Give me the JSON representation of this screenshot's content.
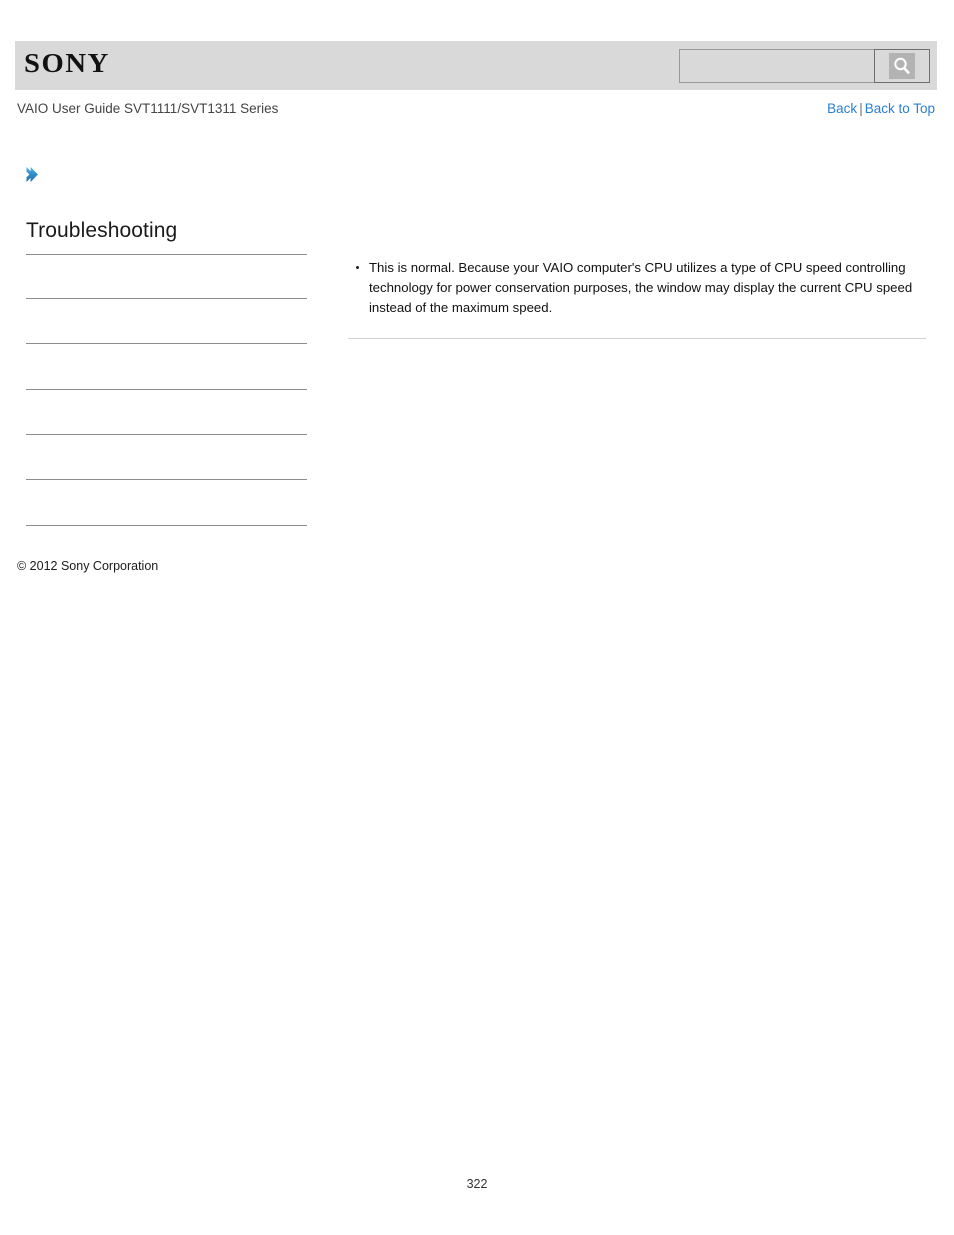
{
  "header": {
    "logo_text": "SONY",
    "search": {
      "value": "",
      "placeholder": "",
      "icon": "search-icon",
      "button_label": ""
    }
  },
  "subheader": {
    "guide_title": "VAIO User Guide SVT1111/SVT1311 Series",
    "links": {
      "back": "Back",
      "separator": "|",
      "back_to_top": "Back to Top"
    }
  },
  "breadcrumb": {
    "icon": "chevron-right-icon",
    "label": ""
  },
  "sidebar": {
    "title": "Troubleshooting",
    "items": [
      {
        "label": ""
      },
      {
        "label": ""
      },
      {
        "label": ""
      },
      {
        "label": ""
      },
      {
        "label": ""
      },
      {
        "label": ""
      },
      {
        "label": ""
      }
    ]
  },
  "main": {
    "bullets": [
      "This is normal. Because your VAIO computer's CPU utilizes a type of CPU speed controlling technology for power conservation purposes, the window may display the current CPU speed instead of the maximum speed."
    ]
  },
  "footer": {
    "copyright": "© 2012 Sony Corporation",
    "page_number": "322"
  },
  "colors": {
    "header_band": "#d9d9d9",
    "link_blue": "#2a7fd4",
    "chevron_blue": "#2f8fce",
    "rule_gray": "#8c8c8c"
  }
}
